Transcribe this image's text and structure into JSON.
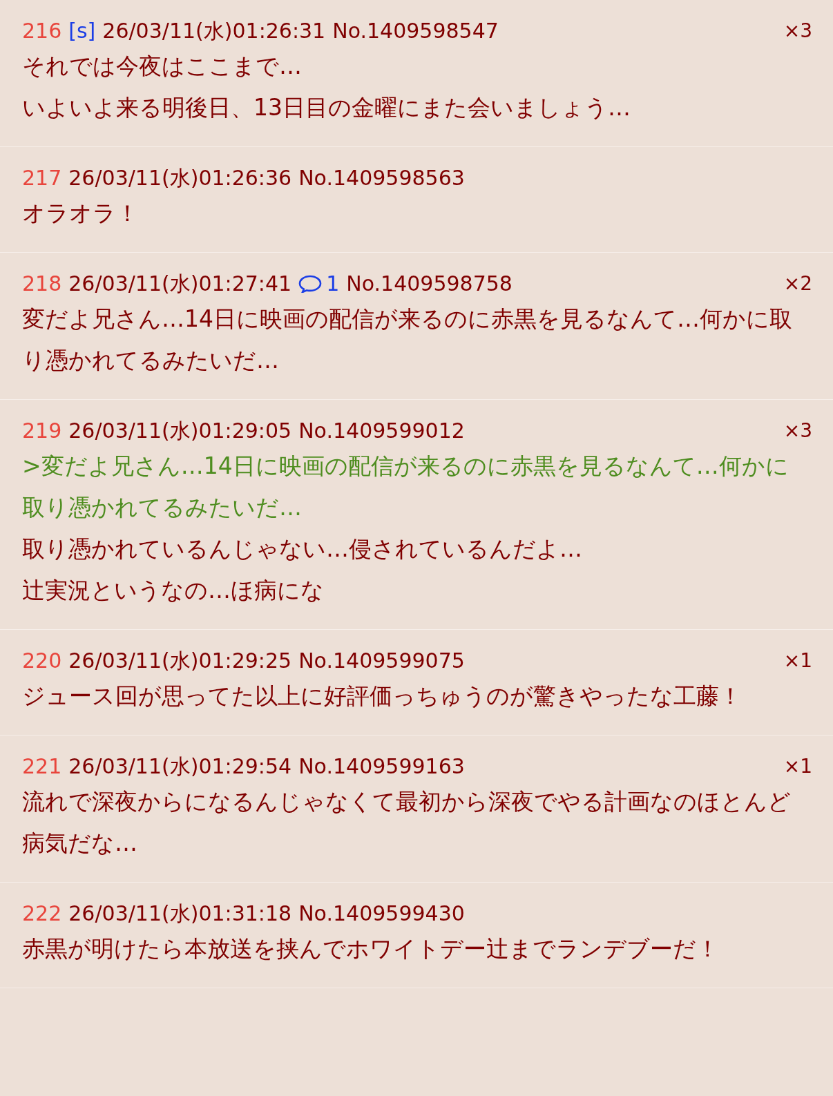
{
  "posts": [
    {
      "number": "216",
      "sage": "[s]",
      "date": "26/03/11(水)01:26:31",
      "no": "No.1409598547",
      "count": "×3",
      "lines": [
        {
          "kind": "text",
          "text": "それでは今夜はここまで…"
        },
        {
          "kind": "text",
          "text": "いよいよ来る明後日、13日目の金曜にまた会いましょう…"
        }
      ]
    },
    {
      "number": "217",
      "date": "26/03/11(水)01:26:36",
      "no": "No.1409598563",
      "lines": [
        {
          "kind": "text",
          "text": "オラオラ！"
        }
      ]
    },
    {
      "number": "218",
      "date": "26/03/11(水)01:27:41",
      "replies": "1",
      "no": "No.1409598758",
      "count": "×2",
      "lines": [
        {
          "kind": "text",
          "text": "変だよ兄さん…14日に映画の配信が来るのに赤黒を見るなんて…何かに取り憑かれてるみたいだ…"
        }
      ]
    },
    {
      "number": "219",
      "date": "26/03/11(水)01:29:05",
      "no": "No.1409599012",
      "count": "×3",
      "lines": [
        {
          "kind": "quote",
          "text": ">変だよ兄さん…14日に映画の配信が来るのに赤黒を見るなんて…何かに取り憑かれてるみたいだ…"
        },
        {
          "kind": "text",
          "text": "取り憑かれているんじゃない…侵されているんだよ…"
        },
        {
          "kind": "text",
          "text": "辻実況というなの…ほ病にな"
        }
      ]
    },
    {
      "number": "220",
      "date": "26/03/11(水)01:29:25",
      "no": "No.1409599075",
      "count": "×1",
      "lines": [
        {
          "kind": "text",
          "text": "ジュース回が思ってた以上に好評価っちゅうのが驚きやったな工藤！"
        }
      ]
    },
    {
      "number": "221",
      "date": "26/03/11(水)01:29:54",
      "no": "No.1409599163",
      "count": "×1",
      "lines": [
        {
          "kind": "text",
          "text": "流れで深夜からになるんじゃなくて最初から深夜でやる計画なのほとんど病気だな…"
        }
      ]
    },
    {
      "number": "222",
      "date": "26/03/11(水)01:31:18",
      "no": "No.1409599430",
      "lines": [
        {
          "kind": "text",
          "text": "赤黒が明けたら本放送を挟んでホワイトデー辻までランデブーだ！"
        }
      ]
    }
  ]
}
